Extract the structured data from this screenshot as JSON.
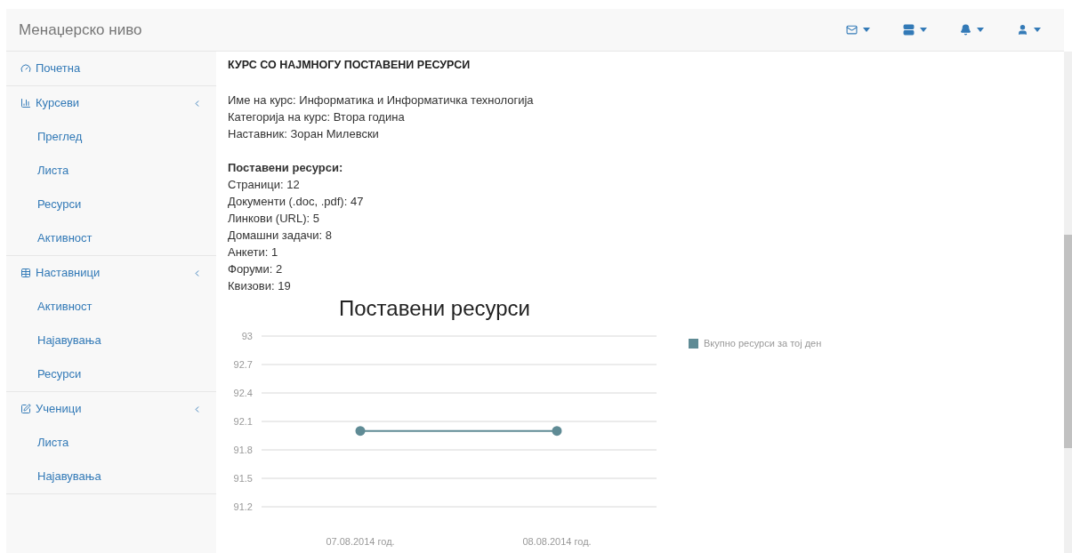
{
  "navbar": {
    "brand": "Менаџерско ниво"
  },
  "sidebar": {
    "items": [
      {
        "label": "Почетна"
      },
      {
        "label": "Курсеви",
        "expanded": true,
        "children": [
          {
            "label": "Преглед"
          },
          {
            "label": "Листа"
          },
          {
            "label": "Ресурси"
          },
          {
            "label": "Активност"
          }
        ]
      },
      {
        "label": "Наставници",
        "expanded": true,
        "children": [
          {
            "label": "Активност"
          },
          {
            "label": "Најавувања"
          },
          {
            "label": "Ресурси"
          }
        ]
      },
      {
        "label": "Ученици",
        "expanded": true,
        "children": [
          {
            "label": "Листа"
          },
          {
            "label": "Најавувања"
          }
        ]
      }
    ]
  },
  "content": {
    "heading": "КУРС СО НАЈМНОГУ ПОСТАВЕНИ РЕСУРСИ",
    "info": [
      "Име на курс: Информатика и Информатичка технологија",
      "Категорија на курс: Втора година",
      "Наставник: Зоран Милевски"
    ],
    "resources_heading": "Поставени ресурси:",
    "resources": [
      "Страници: 12",
      "Документи (.doc, .pdf): 47",
      "Линкови (URL): 5",
      "Домашни задачи: 8",
      "Анкети: 1",
      "Форуми: 2",
      "Квизови: 19"
    ],
    "chart_data": {
      "type": "line",
      "title": "Поставени ресурси",
      "categories": [
        "07.08.2014 год.",
        "08.08.2014 год."
      ],
      "grid": true,
      "series": [
        {
          "name": "Вкупно ресурси за тој ден",
          "color": "#5f8b95",
          "marker": true,
          "values": [
            92,
            92
          ]
        }
      ],
      "ylim": [
        91.2,
        93
      ],
      "yticks": [
        91.2,
        91.5,
        91.8,
        92.1,
        92.4,
        92.7,
        93
      ]
    }
  }
}
